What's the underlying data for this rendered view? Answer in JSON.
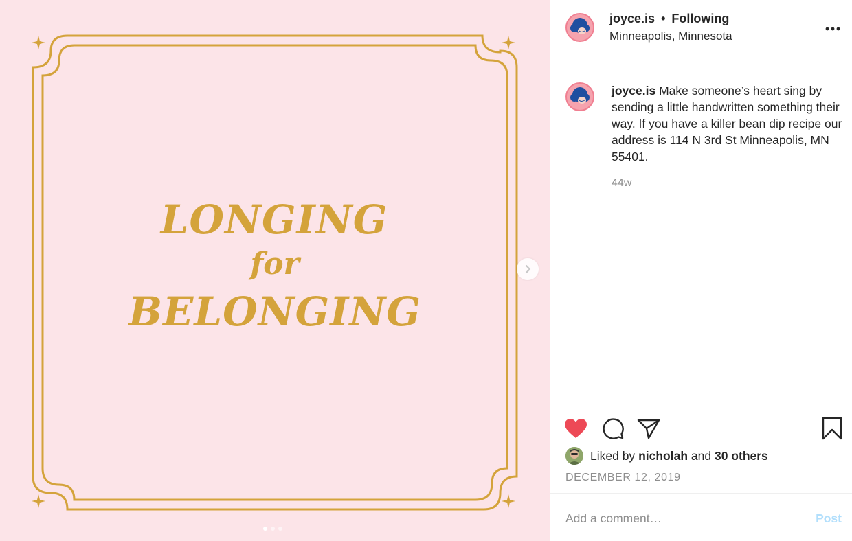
{
  "post_image": {
    "headline_line1": "LONGING",
    "headline_line2": "for",
    "headline_line3": "BELONGING",
    "carousel_slide": 1,
    "carousel_total": 3
  },
  "header": {
    "username": "joyce.is",
    "separator": "•",
    "follow_status": "Following",
    "location": "Minneapolis, Minnesota",
    "more_icon": "more-horizontal-icon"
  },
  "caption": {
    "username": "joyce.is",
    "text": "Make someone’s heart sing by sending a little handwritten something their way. If you have a killer bean dip recipe our address is 114 N 3rd St Minneapolis, MN 55401.",
    "time_ago": "44w"
  },
  "actions": {
    "liked": true,
    "icons": [
      "heart-icon",
      "comment-icon",
      "share-icon",
      "bookmark-icon"
    ]
  },
  "likes": {
    "prefix": "Liked by",
    "liker": "nicholah",
    "conjunction": "and",
    "others": "30 others"
  },
  "post_date": "DECEMBER 12, 2019",
  "comment_box": {
    "placeholder": "Add a comment…",
    "submit_label": "Post"
  },
  "colors": {
    "image_bg": "#fce4e8",
    "gold": "#d4a33b",
    "like_red": "#ed4956",
    "avatar_pink": "#f5a3ae",
    "avatar_blue": "#1f4fa0",
    "post_btn_disabled": "#b2dffc"
  }
}
